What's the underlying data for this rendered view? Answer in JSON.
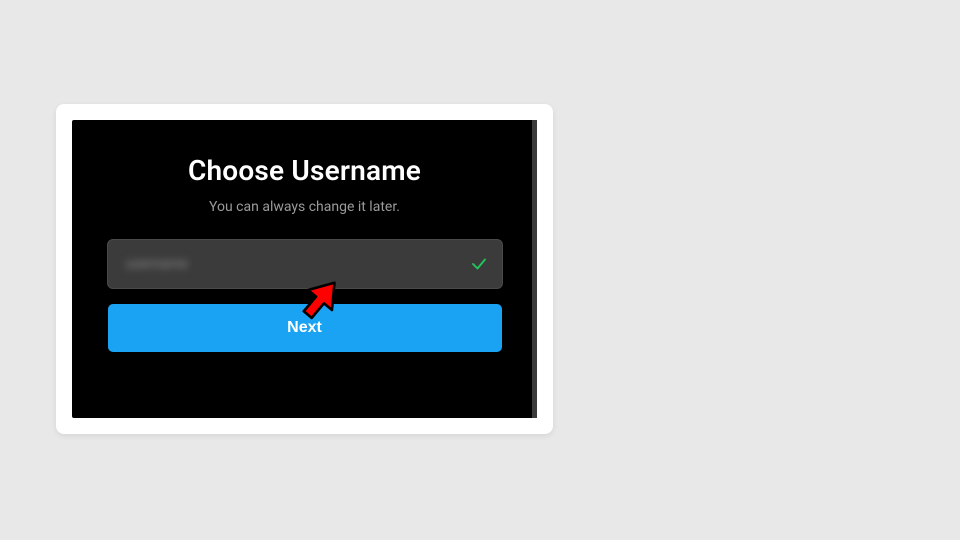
{
  "dialog": {
    "title": "Choose Username",
    "subtitle": "You can always change it later.",
    "username_field": {
      "value": "username",
      "valid": true
    },
    "next_label": "Next"
  },
  "icons": {
    "check": "checkmark-icon",
    "arrow": "red-arrow-cursor"
  },
  "colors": {
    "accent": "#1aa3f2",
    "success": "#23c55e",
    "arrow": "#ff0000"
  }
}
